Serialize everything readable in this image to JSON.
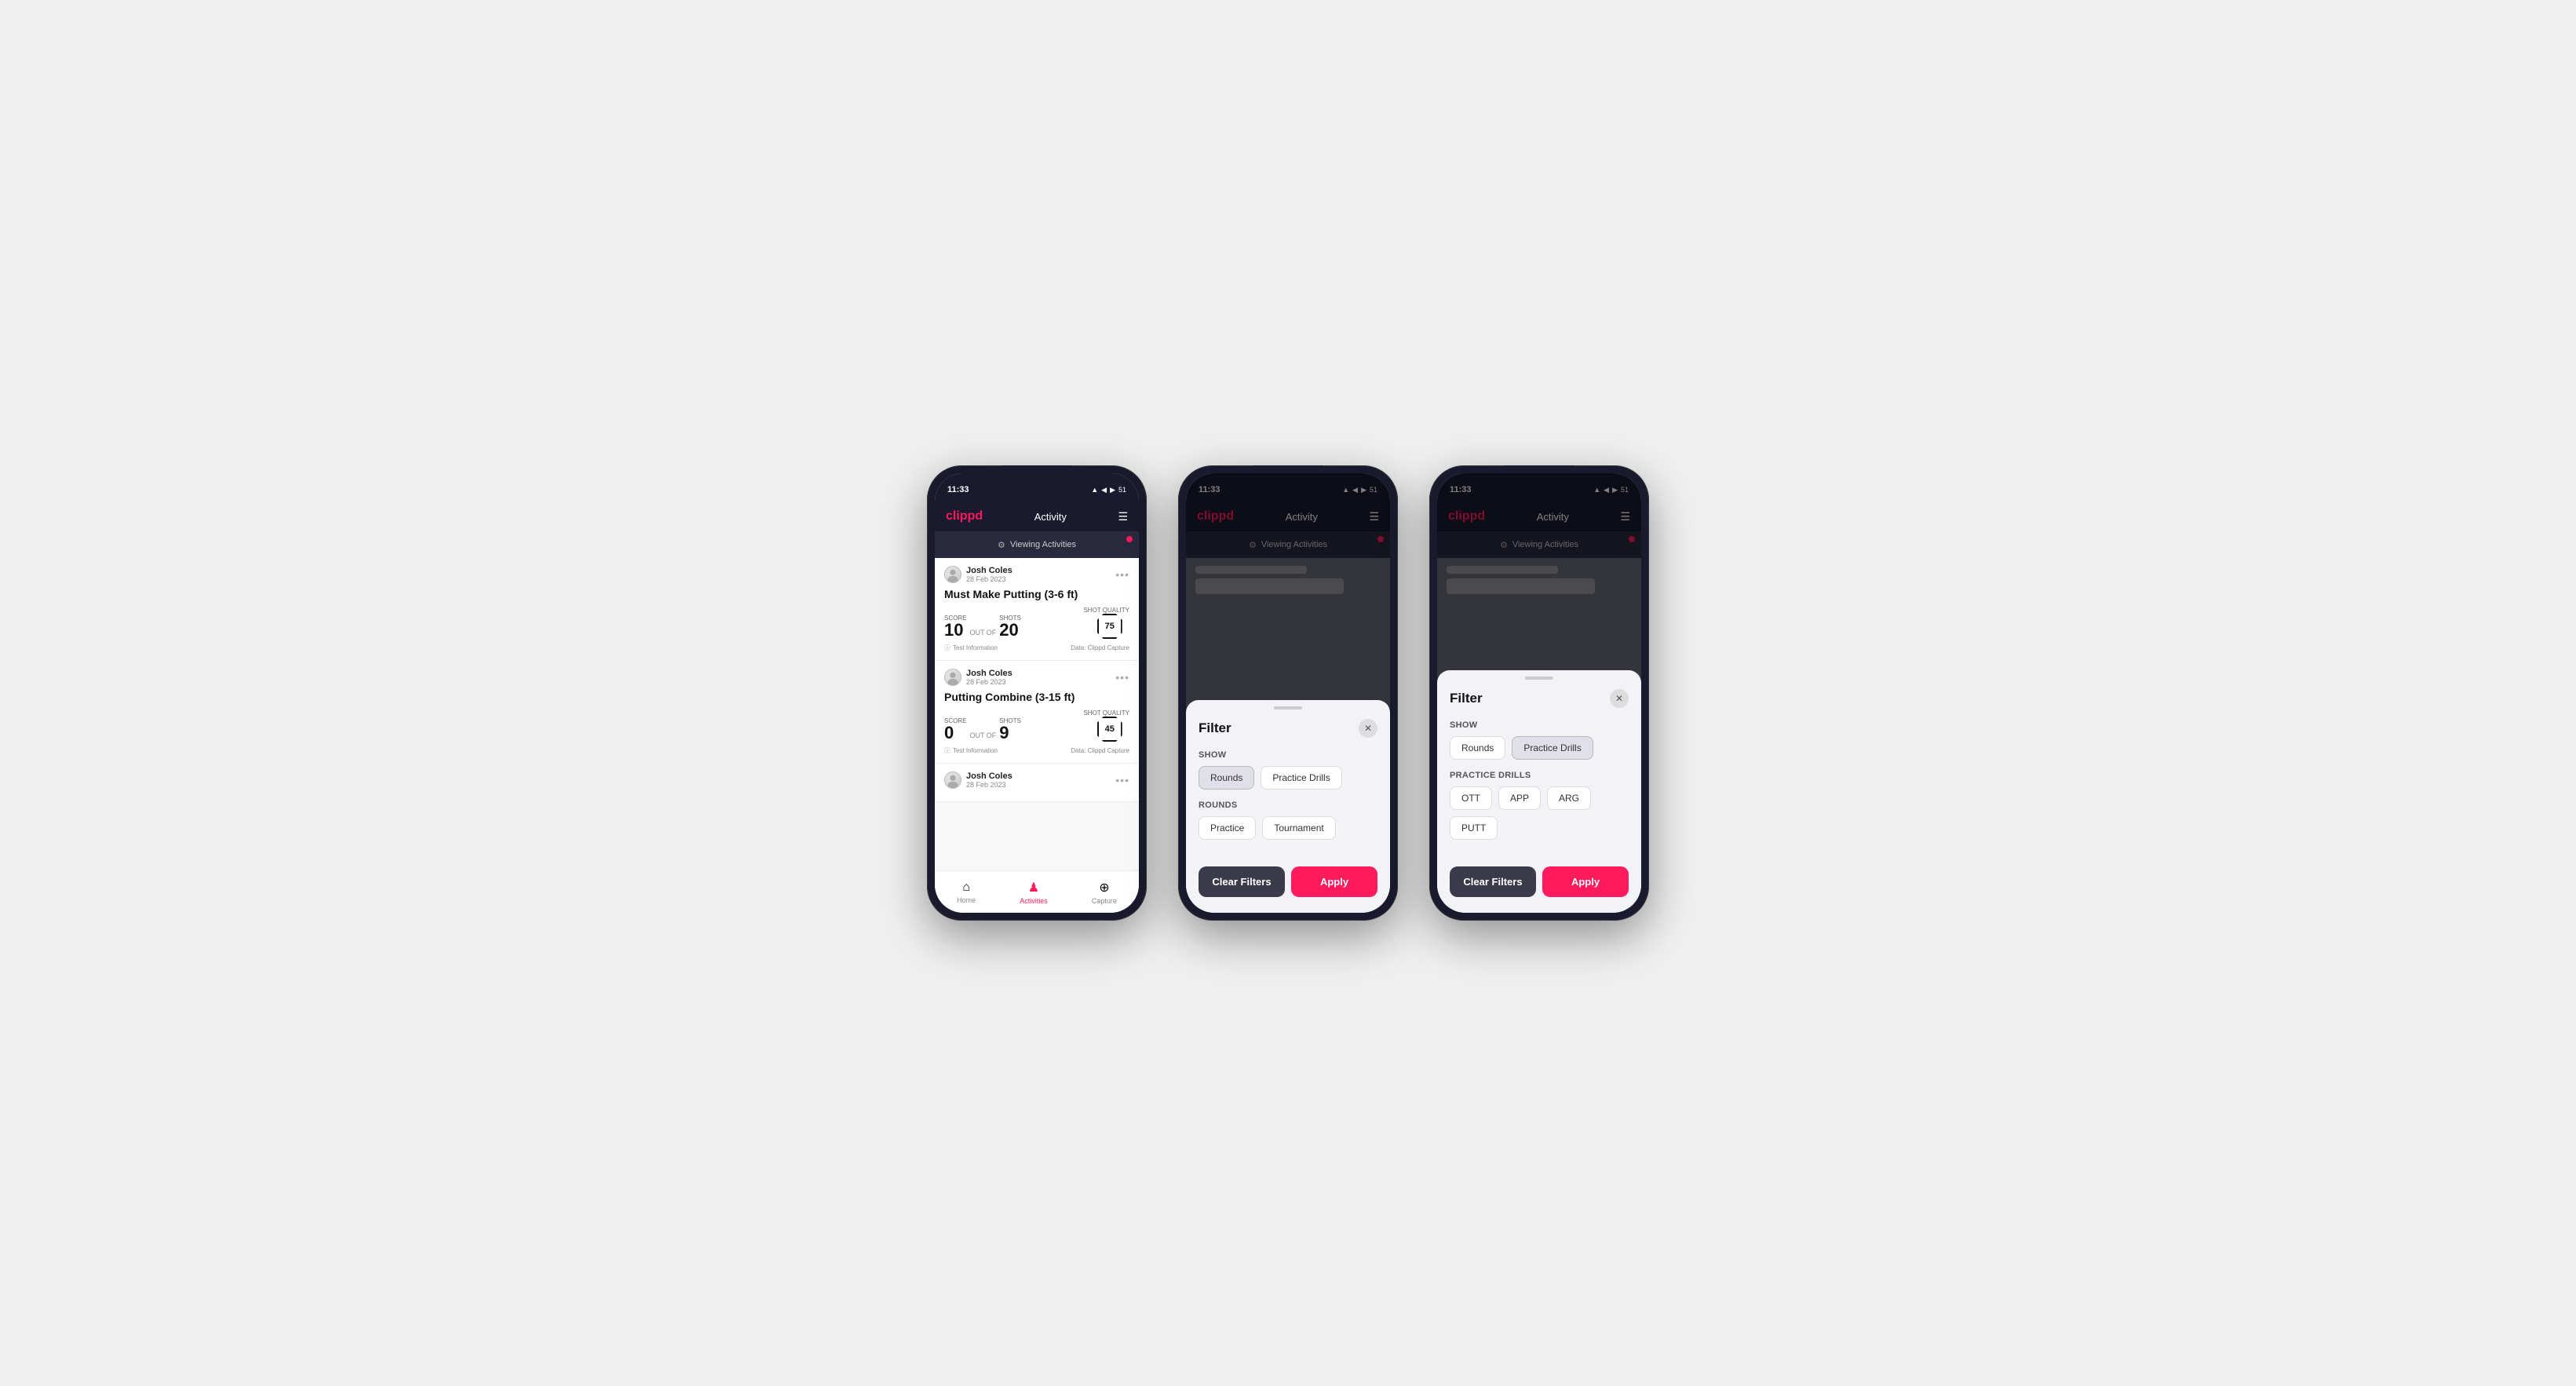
{
  "phones": [
    {
      "id": "phone1",
      "status": {
        "time": "11:33",
        "icons": "▲ ◀ ▶ 51"
      },
      "header": {
        "logo": "clippd",
        "title": "Activity",
        "menu_icon": "☰"
      },
      "viewing_bar": {
        "text": "Viewing Activities"
      },
      "cards": [
        {
          "user_name": "Josh Coles",
          "user_date": "28 Feb 2023",
          "title": "Must Make Putting (3-6 ft)",
          "score_label": "Score",
          "score_value": "10",
          "shots_label": "Shots",
          "shots_value": "20",
          "shot_quality_label": "Shot Quality",
          "shot_quality_value": "75",
          "test_info": "Test Information",
          "data_source": "Data: Clippd Capture"
        },
        {
          "user_name": "Josh Coles",
          "user_date": "28 Feb 2023",
          "title": "Putting Combine (3-15 ft)",
          "score_label": "Score",
          "score_value": "0",
          "shots_label": "Shots",
          "shots_value": "9",
          "shot_quality_label": "Shot Quality",
          "shot_quality_value": "45",
          "test_info": "Test Information",
          "data_source": "Data: Clippd Capture"
        },
        {
          "user_name": "Josh Coles",
          "user_date": "28 Feb 2023",
          "title": "",
          "score_label": "",
          "score_value": "",
          "shots_label": "",
          "shots_value": "",
          "shot_quality_label": "",
          "shot_quality_value": "",
          "test_info": "",
          "data_source": ""
        }
      ],
      "bottom_nav": [
        {
          "label": "Home",
          "icon": "⌂",
          "active": false
        },
        {
          "label": "Activities",
          "icon": "♟",
          "active": true
        },
        {
          "label": "Capture",
          "icon": "⊕",
          "active": false
        }
      ]
    },
    {
      "id": "phone2",
      "status": {
        "time": "11:33",
        "icons": "▲ ◀ ▶ 51"
      },
      "header": {
        "logo": "clippd",
        "title": "Activity",
        "menu_icon": "☰"
      },
      "viewing_bar": {
        "text": "Viewing Activities"
      },
      "filter": {
        "title": "Filter",
        "show_label": "Show",
        "show_buttons": [
          {
            "label": "Rounds",
            "active": true
          },
          {
            "label": "Practice Drills",
            "active": false
          }
        ],
        "rounds_label": "Rounds",
        "rounds_buttons": [
          {
            "label": "Practice",
            "active": false
          },
          {
            "label": "Tournament",
            "active": false
          }
        ],
        "clear_label": "Clear Filters",
        "apply_label": "Apply"
      }
    },
    {
      "id": "phone3",
      "status": {
        "time": "11:33",
        "icons": "▲ ◀ ▶ 51"
      },
      "header": {
        "logo": "clippd",
        "title": "Activity",
        "menu_icon": "☰"
      },
      "viewing_bar": {
        "text": "Viewing Activities"
      },
      "filter": {
        "title": "Filter",
        "show_label": "Show",
        "show_buttons": [
          {
            "label": "Rounds",
            "active": false
          },
          {
            "label": "Practice Drills",
            "active": true
          }
        ],
        "drills_label": "Practice Drills",
        "drills_buttons": [
          {
            "label": "OTT",
            "active": false
          },
          {
            "label": "APP",
            "active": false
          },
          {
            "label": "ARG",
            "active": false
          },
          {
            "label": "PUTT",
            "active": false
          }
        ],
        "clear_label": "Clear Filters",
        "apply_label": "Apply"
      }
    }
  ]
}
